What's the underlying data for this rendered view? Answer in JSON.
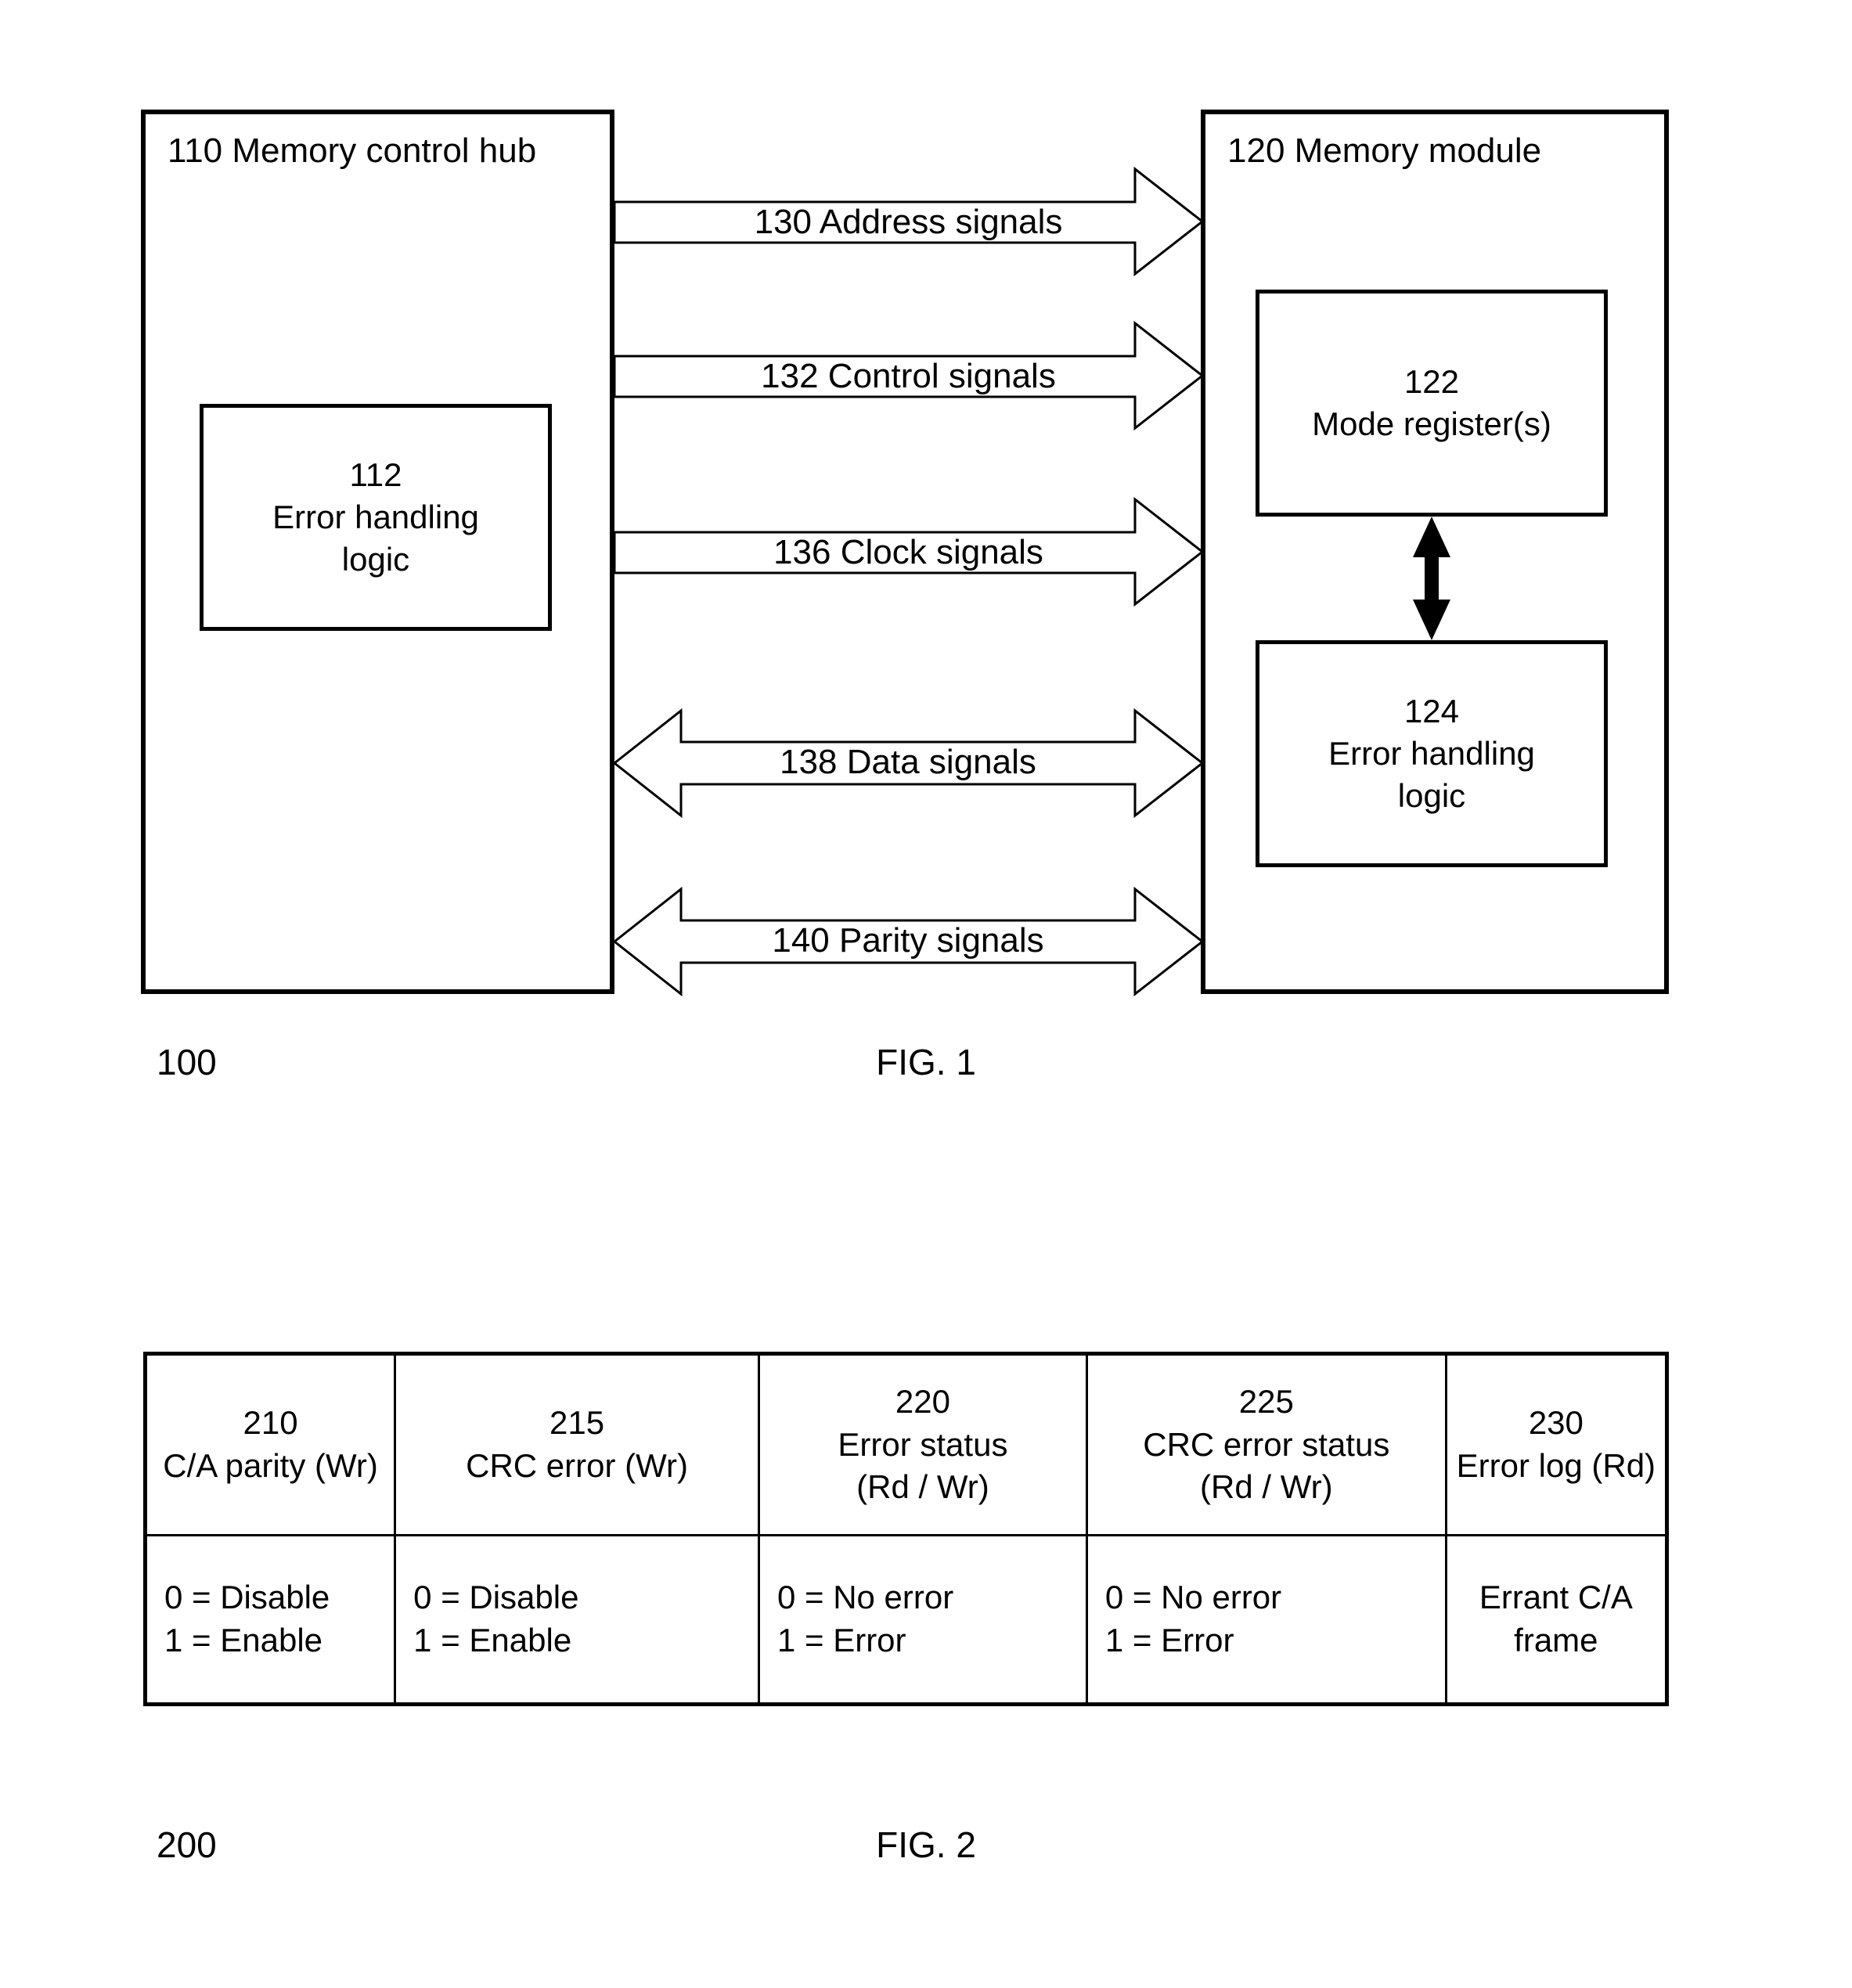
{
  "figure1": {
    "caption_ref": "100",
    "caption": "FIG. 1",
    "hub": {
      "title": "110 Memory control hub",
      "inner": {
        "number": "112",
        "line1": "Error handling",
        "line2": "logic"
      }
    },
    "module": {
      "title": "120 Memory module",
      "mode_register": {
        "number": "122",
        "line1": "Mode register(s)"
      },
      "error_logic": {
        "number": "124",
        "line1": "Error handling",
        "line2": "logic"
      }
    },
    "signals": [
      {
        "label": "130 Address signals",
        "direction": "right"
      },
      {
        "label": "132 Control signals",
        "direction": "right"
      },
      {
        "label": "136 Clock signals",
        "direction": "right"
      },
      {
        "label": "138 Data signals",
        "direction": "both"
      },
      {
        "label": "140 Parity signals",
        "direction": "both"
      }
    ]
  },
  "figure2": {
    "caption_ref": "200",
    "caption": "FIG. 2",
    "table": {
      "headers": [
        {
          "number": "210",
          "line1": "C/A parity (Wr)",
          "line2": ""
        },
        {
          "number": "215",
          "line1": "CRC error (Wr)",
          "line2": ""
        },
        {
          "number": "220",
          "line1": "Error status",
          "line2": "(Rd / Wr)"
        },
        {
          "number": "225",
          "line1": "CRC error status",
          "line2": "(Rd / Wr)"
        },
        {
          "number": "230",
          "line1": "Error log (Rd)",
          "line2": ""
        }
      ],
      "values": [
        {
          "line1": "0 = Disable",
          "line2": "1 = Enable",
          "align": "left"
        },
        {
          "line1": "0 = Disable",
          "line2": "1 = Enable",
          "align": "left"
        },
        {
          "line1": "0 = No error",
          "line2": "1 = Error",
          "align": "left"
        },
        {
          "line1": "0 = No error",
          "line2": "1 = Error",
          "align": "left"
        },
        {
          "line1": "Errant C/A frame",
          "line2": "",
          "align": "center"
        }
      ]
    }
  },
  "colors": {
    "ink": "#000000",
    "paper": "#ffffff"
  }
}
